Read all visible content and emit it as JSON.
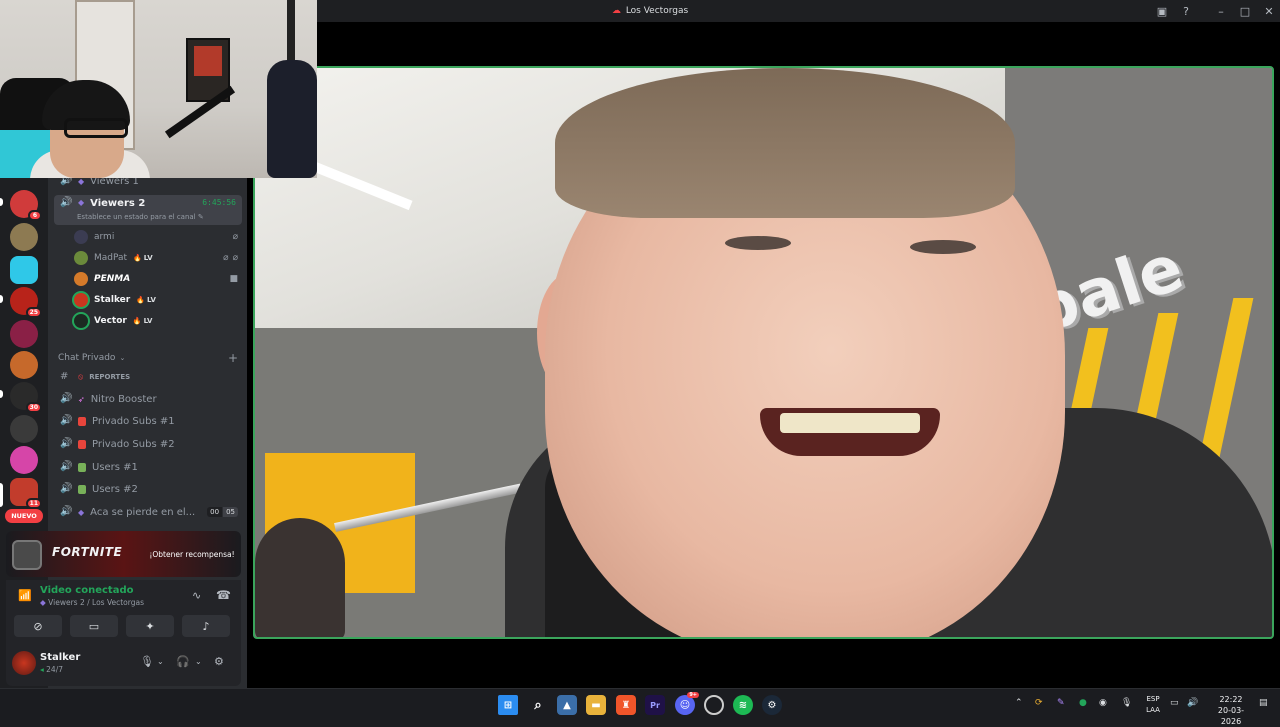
{
  "window": {
    "title": "Los Vectorgas"
  },
  "channels": {
    "viewers1_label": "Viewers 1",
    "viewers2": {
      "label": "Viewers 2",
      "timer": "6:45:56",
      "status_hint": "Establece un estado para el canal"
    },
    "users": [
      {
        "name": "armi",
        "badge": ""
      },
      {
        "name": "MadPat",
        "badge": "LV"
      },
      {
        "name": "PENMA",
        "badge": ""
      },
      {
        "name": "Stalker",
        "badge": "LV"
      },
      {
        "name": "Vector",
        "badge": "LV"
      }
    ],
    "category": "Chat Privado",
    "items": [
      {
        "label": "REPORTES"
      },
      {
        "label": "Nitro Booster"
      },
      {
        "label": "Privado Subs #1"
      },
      {
        "label": "Privado Subs #2"
      },
      {
        "label": "Users #1"
      },
      {
        "label": "Users #2"
      },
      {
        "label": "Aca se pierde en el..."
      }
    ],
    "last_counts": [
      "00",
      "05"
    ]
  },
  "servers": {
    "badges": [
      "6",
      "25",
      "30",
      "11"
    ],
    "nuevo_label": "NUEVO"
  },
  "promo": {
    "game": "FORTNITE",
    "cta": "¡Obtener recompensa!"
  },
  "voice": {
    "status": "Video conectado",
    "location": "Viewers 2 / Los Vectorgas"
  },
  "user": {
    "name": "Stalker",
    "status": "24/7"
  },
  "taskbar": {
    "badge_count": "9+",
    "language": "ESP",
    "layout": "LAA",
    "time": "22:22",
    "date": "20-03-2026"
  },
  "colors": {
    "accent_green": "#23a55a",
    "speaking_border": "#3ba55c",
    "badge_red": "#f23f43"
  }
}
